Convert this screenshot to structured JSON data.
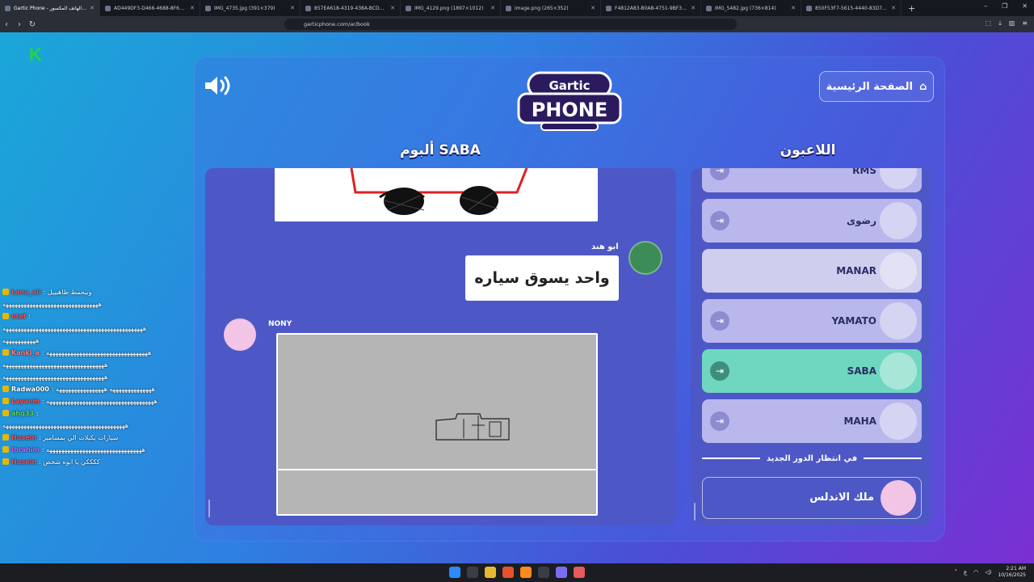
{
  "browser": {
    "tabs": [
      {
        "title": "Gartic Phone - لعبة الهاتف المكسور",
        "active": true
      },
      {
        "title": "AD449DF3-D466-4688-8F60-1676F..."
      },
      {
        "title": "IMG_4735.jpg (391×379)"
      },
      {
        "title": "857EA618-4319-438A-BCDA-0AEB5..."
      },
      {
        "title": "IMG_4129.png (1897×1012)"
      },
      {
        "title": "image.png (265×352)"
      },
      {
        "title": "F4812A83-B0A8-4751-9BF3-AFAD0..."
      },
      {
        "title": "IMG_5482.jpg (736×814)"
      },
      {
        "title": "850F53F7-5615-4440-83D7-D4CD6..."
      }
    ],
    "new_tab": "+",
    "url": "garticphone.com/ar/book"
  },
  "game": {
    "home_button": "الصفحة الرئيسية",
    "album_title": "ألبوم SABA",
    "players_title": "اللاعبون",
    "logo_line1": "Gartic",
    "logo_line2": "PHONE",
    "speech_author": "ابو هند",
    "speech_text": "واحد يسوق سياره",
    "drawer_name": "NONY",
    "players": [
      {
        "name": "RMS",
        "state": "normal"
      },
      {
        "name": "رضوى",
        "state": "normal"
      },
      {
        "name": "MANAR",
        "state": "self"
      },
      {
        "name": "YAMATO",
        "state": "normal"
      },
      {
        "name": "SABA",
        "state": "active"
      },
      {
        "name": "MAHA",
        "state": "normal"
      }
    ],
    "waiting_label": "في انتظار الدور الجديد",
    "waiting_player": "ملك الاندلس"
  },
  "chat": [
    {
      "user": "Lana_ali",
      "text": "وبيحمط ظاهبييل",
      "user_color": "#ff4a4a"
    },
    {
      "user": "",
      "text": "ههههههههههههههههههههههههههههههههه"
    },
    {
      "user": "otef",
      "text": "",
      "user_color": "#ff4a4a"
    },
    {
      "user": "",
      "text": "هههههههههههههههههههههههههههههههههههههههههههههههه"
    },
    {
      "user": "",
      "text": "هههههههههههه"
    },
    {
      "user": "Kanki_a",
      "text": "ههههههههههههههههههههههههههههههههههه",
      "user_color": "#ff7a7a"
    },
    {
      "user": "",
      "text": "ههههههههههههههههههههههههههههههههههه"
    },
    {
      "user": "",
      "text": "ههههههههههههههههههههههههههههههههههه"
    },
    {
      "user": "Radwa000",
      "text": "ههههههههههههههه ههههههههههههههههه",
      "user_color": "#ffffff"
    },
    {
      "user": "Layanm",
      "text": "ههههههههههههههههههههههههههههههههههههه",
      "user_color": "#ff4a4a"
    },
    {
      "user": "ahq33",
      "text": "",
      "user_color": "#57d957"
    },
    {
      "user": "",
      "text": "هههههههههههههههههههههههههههههههههههههههههه"
    },
    {
      "user": "Husein",
      "text": "سيارات يكبلات الي بمسامير",
      "user_color": "#ff4a4a"
    },
    {
      "user": "Ibrahim",
      "text": "ههههههههههههههههههههههههههههههههه",
      "user_color": "#c062ff"
    },
    {
      "user": "Husein",
      "text": "ككككي يا ابوه شخص",
      "user_color": "#ff4a4a"
    }
  ],
  "taskbar": {
    "lang": "ع",
    "time": "2:21 AM",
    "date": "10/16/2025"
  },
  "colors": {
    "accent_green": "#6fd7bf",
    "panel_blue": "#4d58c6",
    "player_card": "#b9b7ec"
  }
}
